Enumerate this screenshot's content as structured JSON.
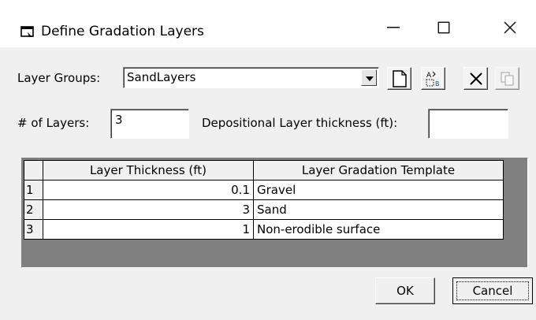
{
  "window": {
    "title": "Define Gradation Layers",
    "minimize_glyph": "—",
    "close_glyph": "✕"
  },
  "layer_groups": {
    "label": "Layer Groups:",
    "selected": "SandLayers",
    "tools": [
      "new-icon",
      "rename-icon",
      "delete-icon",
      "copy-icon"
    ]
  },
  "layers": {
    "count_label": "# of Layers:",
    "count_value": "3",
    "depositional_label": "Depositional Layer thickness (ft):",
    "depositional_value": ""
  },
  "table": {
    "columns": [
      "Layer Thickness (ft)",
      "Layer Gradation Template"
    ],
    "rows": [
      {
        "index": "1",
        "thickness": "0.1",
        "template": "Gravel"
      },
      {
        "index": "2",
        "thickness": "3",
        "template": "Sand"
      },
      {
        "index": "3",
        "thickness": "1",
        "template": "Non-erodible surface"
      }
    ]
  },
  "buttons": {
    "ok": "OK",
    "cancel": "Cancel"
  },
  "colors": {
    "dialog_bg": "#f0f0f0",
    "titlebar_bg": "#ffffff",
    "grid_bg": "#808080"
  }
}
